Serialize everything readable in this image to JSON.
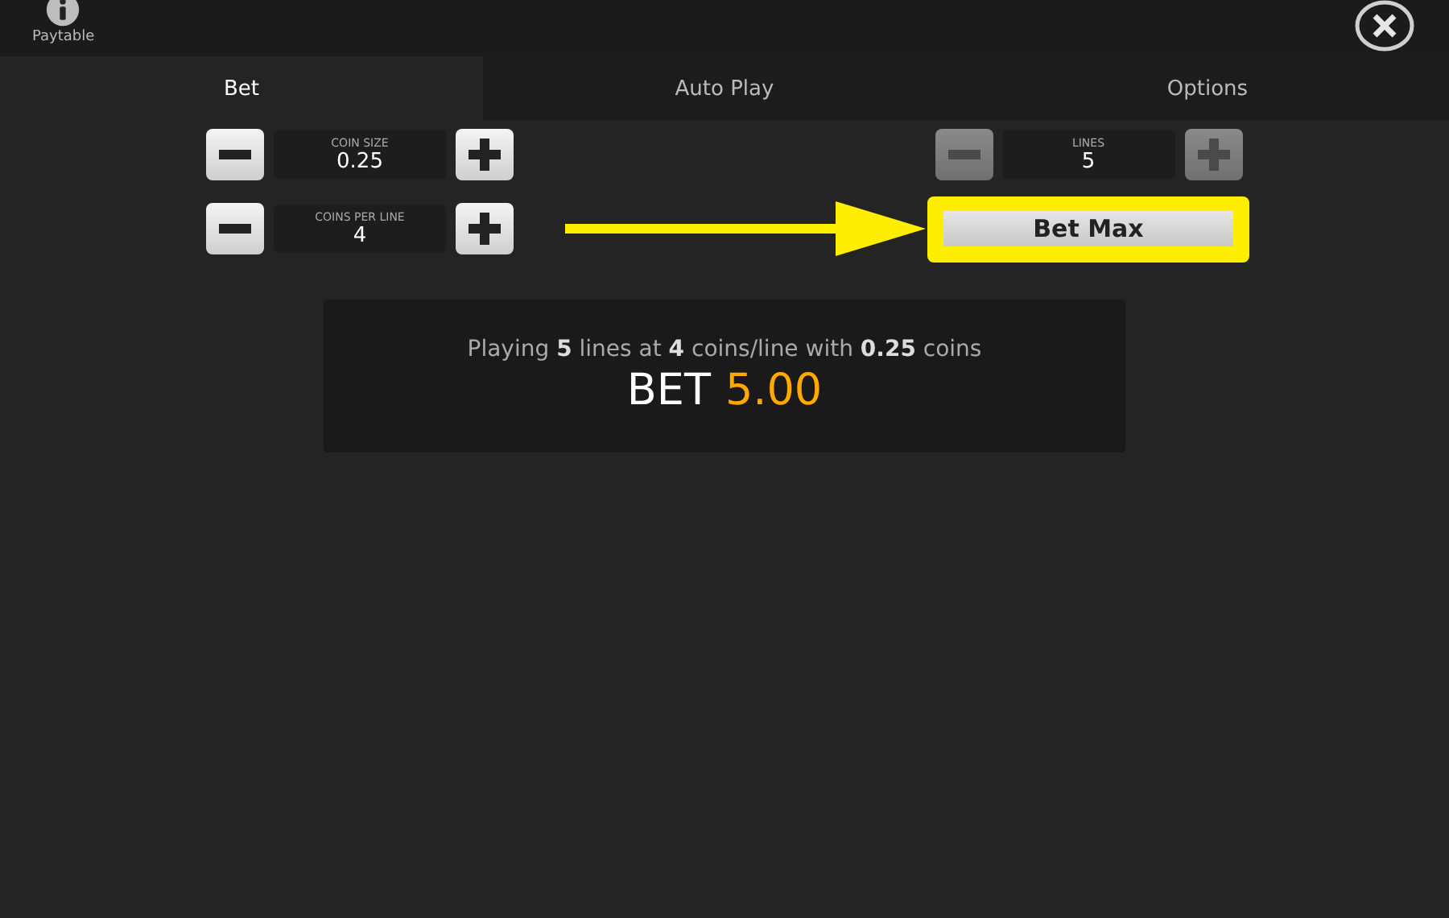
{
  "paytable": {
    "label": "Paytable"
  },
  "tabs": [
    {
      "label": "Bet",
      "selected": true
    },
    {
      "label": "Auto Play",
      "selected": false
    },
    {
      "label": "Options",
      "selected": false
    }
  ],
  "steppers": [
    {
      "label": "COIN SIZE",
      "value": "0.25",
      "disabled": false
    },
    {
      "label": "LINES",
      "value": "5",
      "disabled": true
    },
    {
      "label": "COINS PER LINE",
      "value": "4",
      "disabled": false
    }
  ],
  "bet_max": {
    "label": "Bet Max",
    "highlighted": true
  },
  "summary": {
    "text": "Playing **5** lines at **4** coins/line with **0.25** coins",
    "bet_label": "BET",
    "bet_value": "5.00"
  }
}
